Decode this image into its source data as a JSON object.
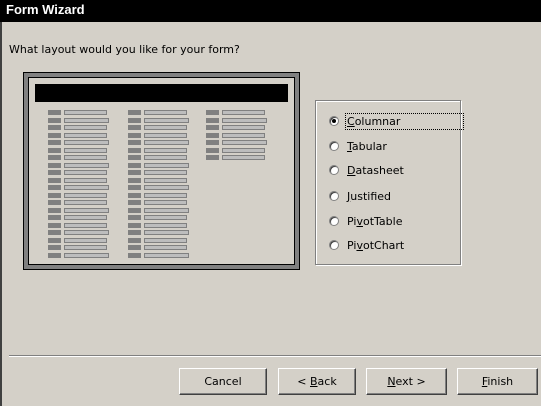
{
  "window": {
    "title": "Form Wizard"
  },
  "question": "What layout would you like for your form?",
  "layout_options": [
    {
      "label": "Columnar",
      "mnemonic": "C",
      "rest": "olumnar",
      "checked": true
    },
    {
      "label": "Tabular",
      "mnemonic": "T",
      "rest": "abular",
      "checked": false
    },
    {
      "label": "Datasheet",
      "mnemonic": "D",
      "rest": "atasheet",
      "checked": false
    },
    {
      "label": "Justified",
      "mnemonic": "J",
      "rest": "ustified",
      "checked": false
    },
    {
      "label": "PivotTable",
      "pre": "Pi",
      "mnemonic": "v",
      "rest": "otTable",
      "checked": false
    },
    {
      "label": "PivotChart",
      "pre": "Pi",
      "mnemonic": "v",
      "rest": "otChart",
      "checked": false
    }
  ],
  "buttons": {
    "cancel": "Cancel",
    "back_arrow": "< ",
    "back_mnemonic": "B",
    "back_rest": "ack",
    "next_mnemonic": "N",
    "next_rest": "ext >",
    "finish_mnemonic": "F",
    "finish_rest": "inish"
  },
  "colors": {
    "titlebar": "#000000",
    "dialog": "#d4d0c8"
  }
}
